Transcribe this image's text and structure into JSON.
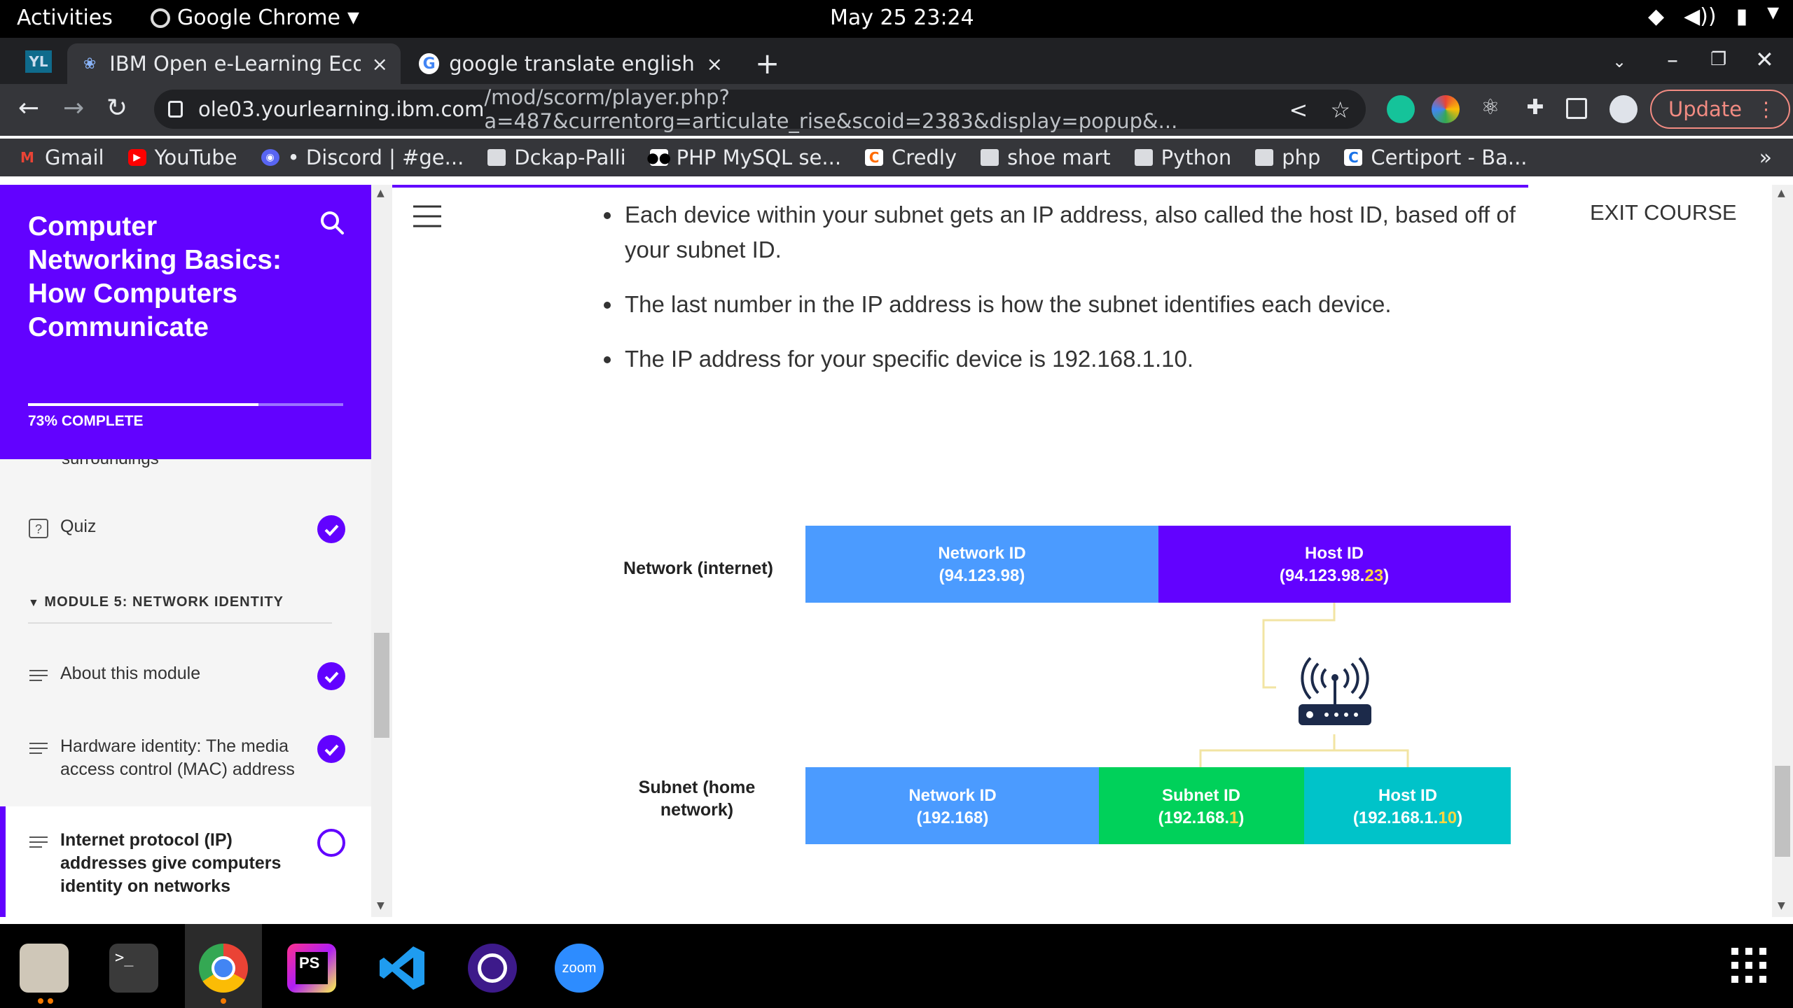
{
  "topbar": {
    "activities": "Activities",
    "app_name": "Google Chrome",
    "clock": "May 25  23:24"
  },
  "tabs": [
    {
      "label": "IBM Open e-Learning Ecos",
      "close": "×",
      "active": true
    },
    {
      "label": "google translate english t",
      "close": "×",
      "active": false
    }
  ],
  "tabstrip": {
    "new_tab": "+"
  },
  "omnibox": {
    "host": "ole03.yourlearning.ibm.com",
    "path": "/mod/scorm/player.php?a=487&currentorg=articulate_rise&scoid=2383&display=popup&..."
  },
  "update_button": "Update",
  "bookmarks": [
    {
      "label": "Gmail",
      "icon": "gmail-icon"
    },
    {
      "label": "YouTube",
      "icon": "youtube-icon"
    },
    {
      "label": "• Discord | #ge...",
      "icon": "discord-icon"
    },
    {
      "label": "Dckap-Palli",
      "icon": "folder-icon"
    },
    {
      "label": "PHP MySQL se...",
      "icon": "medium-icon"
    },
    {
      "label": "Credly",
      "icon": "credly-icon"
    },
    {
      "label": "shoe mart",
      "icon": "folder-icon"
    },
    {
      "label": "Python",
      "icon": "folder-icon"
    },
    {
      "label": "php",
      "icon": "folder-icon"
    },
    {
      "label": "Certiport - Ba...",
      "icon": "certiport-icon"
    }
  ],
  "bookmarks_more": "»",
  "sidebar": {
    "course_title": "Computer Networking Basics: How Computers Communicate",
    "progress_label": "73% COMPLETE",
    "progress_fraction": 0.73,
    "clipped_item_text": "surroundings",
    "module_label": "MODULE 5: NETWORK IDENTITY",
    "items": [
      {
        "label": "Quiz",
        "status": "complete"
      },
      {
        "label": "About this module",
        "status": "complete"
      },
      {
        "label": "Hardware identity: The media access control (MAC) address",
        "status": "complete"
      },
      {
        "label": "Internet protocol (IP) addresses give computers identity on networks",
        "status": "in-progress"
      }
    ]
  },
  "main": {
    "exit_course": "EXIT COURSE",
    "bullets": [
      "Each device within your subnet gets an IP address, also called the host ID, based off of your subnet ID.",
      "The last number in the IP address is how the subnet identifies each device.",
      "The IP address for your specific device is 192.168.1.10."
    ]
  },
  "diagram": {
    "row1_label": "Network (internet)",
    "row1_network": {
      "title": "Network ID",
      "value": "(94.123.98)"
    },
    "row1_host": {
      "title": "Host ID",
      "prefix": "(94.123.98.",
      "highlight": "23",
      "suffix": ")"
    },
    "row2_label_line1": "Subnet (home",
    "row2_label_line2": "network)",
    "row2_network": {
      "title": "Network ID",
      "value": "(192.168)"
    },
    "row2_subnet": {
      "title": "Subnet ID",
      "prefix": "(192.168.",
      "highlight": "1",
      "suffix": ")"
    },
    "row2_host": {
      "title": "Host ID",
      "prefix": "(192.168.1.",
      "highlight": "10",
      "suffix": ")"
    },
    "colors": {
      "network_blue": "#4b9bff",
      "host_purple": "#6202ff",
      "subnet_green": "#00d15a",
      "host_teal": "#00c3c9",
      "highlight_yellow": "#ffd63f",
      "connector": "#f2e4a3"
    }
  },
  "dock_apps": [
    "files-icon",
    "terminal-icon",
    "chrome-icon",
    "phpstorm-icon",
    "vscode-icon",
    "obs-icon",
    "zoom-icon"
  ],
  "zoom_label": "zoom",
  "phpstorm_label": "PS"
}
